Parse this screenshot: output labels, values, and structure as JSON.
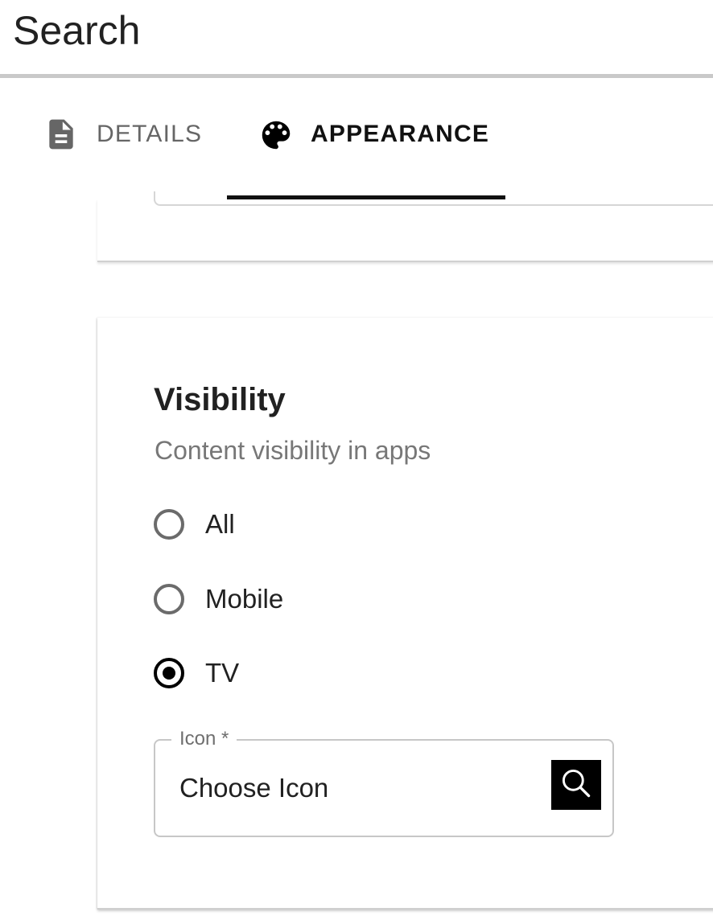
{
  "header": {
    "title": "Search"
  },
  "tabs": [
    {
      "label": "DETAILS",
      "icon": "document-icon",
      "active": false
    },
    {
      "label": "APPEARANCE",
      "icon": "palette-icon",
      "active": true
    }
  ],
  "visibility": {
    "title": "Visibility",
    "subtitle": "Content visibility in apps",
    "options": [
      {
        "label": "All",
        "checked": false
      },
      {
        "label": "Mobile",
        "checked": false
      },
      {
        "label": "TV",
        "checked": true
      }
    ],
    "icon_field": {
      "label": "Icon *",
      "value": "Choose Icon",
      "button_icon": "search-icon"
    }
  },
  "colors": {
    "accent": "#000000",
    "inactive_tab": "#666666",
    "subtitle": "#777777"
  }
}
